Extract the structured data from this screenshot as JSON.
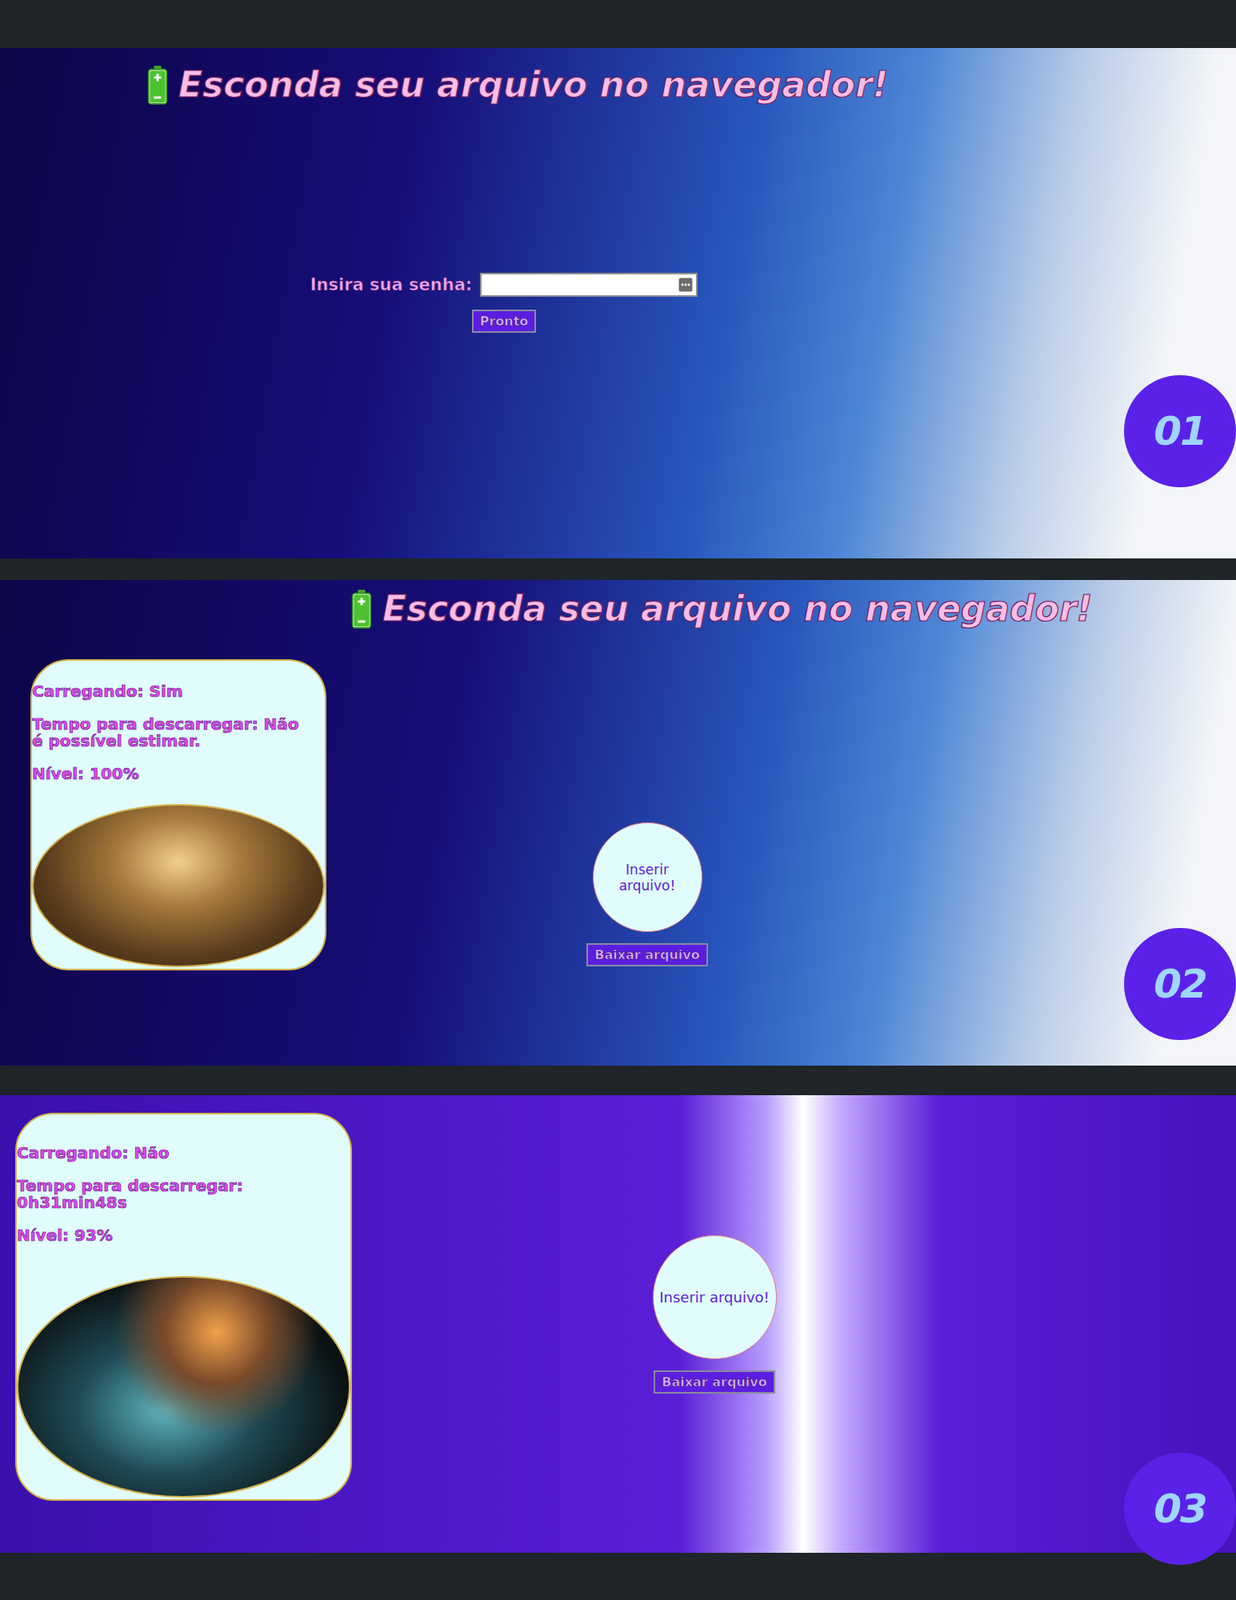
{
  "panels": [
    {
      "kind": "login",
      "badge": "01",
      "title": {
        "text": "Esconda seu arquivo no navegador!",
        "icon_level": 1
      },
      "password": {
        "label": "Insira sua senha:",
        "value": "",
        "button": "Pronto"
      }
    },
    {
      "kind": "upload",
      "badge": "02",
      "title": {
        "text": "Esconda seu arquivo no navegador!",
        "icon_level": 1
      },
      "battery": {
        "charging": "Carregando: Sim",
        "time": "Tempo para descarregar: Não é possível estimar.",
        "level": "Nível: 100%"
      },
      "upload": {
        "drop": "Inserir arquivo!",
        "download": "Baixar arquivo"
      }
    },
    {
      "kind": "upload",
      "badge": "03",
      "battery": {
        "charging": "Carregando: Não",
        "time": "Tempo para descarregar: 0h31min48s",
        "level": "Nível: 93%"
      },
      "upload": {
        "drop": "Inserir arquivo!",
        "download": "Baixar arquivo"
      }
    }
  ]
}
